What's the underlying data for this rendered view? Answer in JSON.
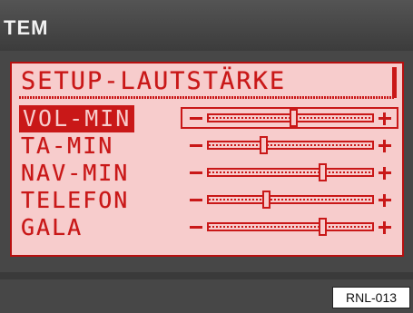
{
  "header": {
    "title": "TEM"
  },
  "screen": {
    "heading": "SETUP-LAUTSTÄRKE",
    "rows": [
      {
        "label": "VOL-MIN",
        "level": 0.52,
        "selected": true
      },
      {
        "label": "TA-MIN",
        "level": 0.33,
        "selected": false
      },
      {
        "label": "NAV-MIN",
        "level": 0.7,
        "selected": false
      },
      {
        "label": "TELEFON",
        "level": 0.35,
        "selected": false
      },
      {
        "label": "GALA",
        "level": 0.7,
        "selected": false
      }
    ]
  },
  "figure_code": "RNL-013",
  "colors": {
    "lcd_text": "#c91818",
    "lcd_bg": "#f7cccc",
    "frame": "#474747"
  },
  "icons": {
    "minus": "minus-icon",
    "plus": "plus-icon"
  }
}
